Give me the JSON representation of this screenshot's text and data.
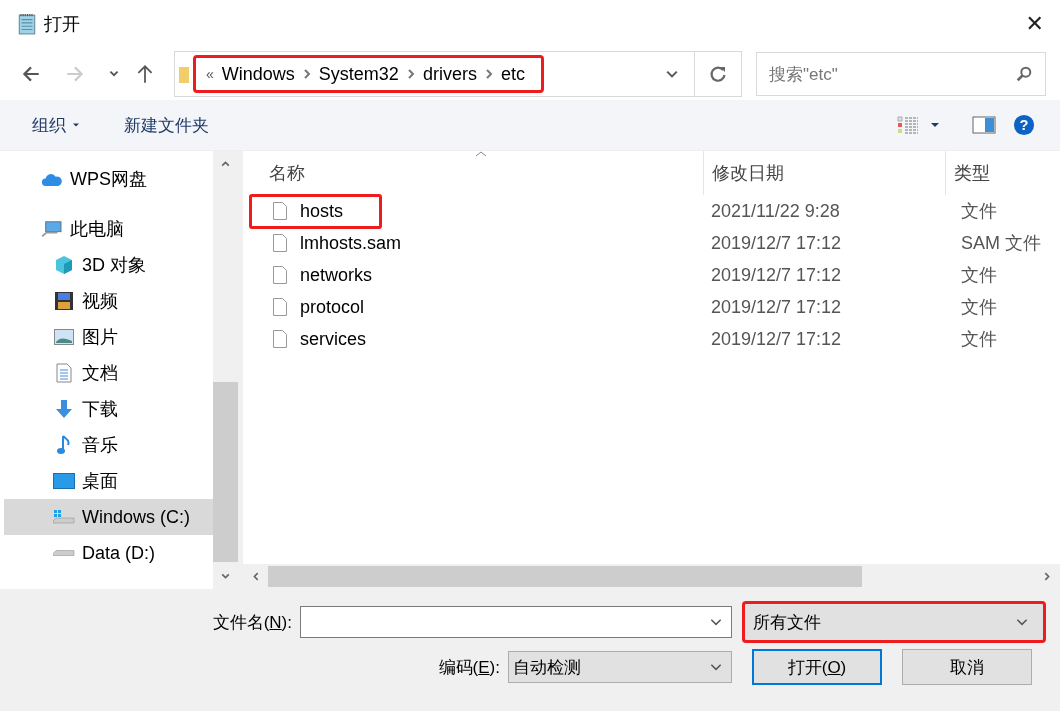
{
  "window": {
    "title": "打开",
    "close": "✕"
  },
  "nav": {
    "breadcrumb_prefix": "«",
    "path": [
      "Windows",
      "System32",
      "drivers",
      "etc"
    ],
    "highlighted": true,
    "search_placeholder": "搜索\"etc\""
  },
  "toolbar": {
    "organize": "组织",
    "new_folder": "新建文件夹",
    "help": "?"
  },
  "sidebar": {
    "items": [
      {
        "label": "WPS网盘",
        "kind": "cloud",
        "selected": false
      },
      {
        "label": "此电脑",
        "kind": "pc",
        "selected": false,
        "children": [
          {
            "label": "3D 对象",
            "kind": "cube",
            "selected": false
          },
          {
            "label": "视频",
            "kind": "film",
            "selected": false
          },
          {
            "label": "图片",
            "kind": "image",
            "selected": false
          },
          {
            "label": "文档",
            "kind": "doc",
            "selected": false
          },
          {
            "label": "下载",
            "kind": "download",
            "selected": false
          },
          {
            "label": "音乐",
            "kind": "music",
            "selected": false
          },
          {
            "label": "桌面",
            "kind": "desktop",
            "selected": false
          },
          {
            "label": "Windows (C:)",
            "kind": "windrive",
            "selected": true
          },
          {
            "label": "Data (D:)",
            "kind": "drive",
            "selected": false
          }
        ]
      }
    ]
  },
  "table": {
    "columns": [
      "名称",
      "修改日期",
      "类型"
    ],
    "rows": [
      {
        "name": "hosts",
        "date": "2021/11/22 9:28",
        "type": "文件",
        "highlighted": true
      },
      {
        "name": "lmhosts.sam",
        "date": "2019/12/7 17:12",
        "type": "SAM 文件",
        "highlighted": false
      },
      {
        "name": "networks",
        "date": "2019/12/7 17:12",
        "type": "文件",
        "highlighted": false
      },
      {
        "name": "protocol",
        "date": "2019/12/7 17:12",
        "type": "文件",
        "highlighted": false
      },
      {
        "name": "services",
        "date": "2019/12/7 17:12",
        "type": "文件",
        "highlighted": false
      }
    ]
  },
  "footer": {
    "filename": {
      "before": "文件名(",
      "key": "N",
      "after": "):"
    },
    "filetype": {
      "value": "所有文件",
      "highlighted": true
    },
    "encoding_label": {
      "before": "编码(",
      "key": "E",
      "after": "):"
    },
    "encoding": "自动检测",
    "open": {
      "before": "打开(",
      "key": "O",
      "after": ")"
    },
    "cancel": "取消"
  }
}
